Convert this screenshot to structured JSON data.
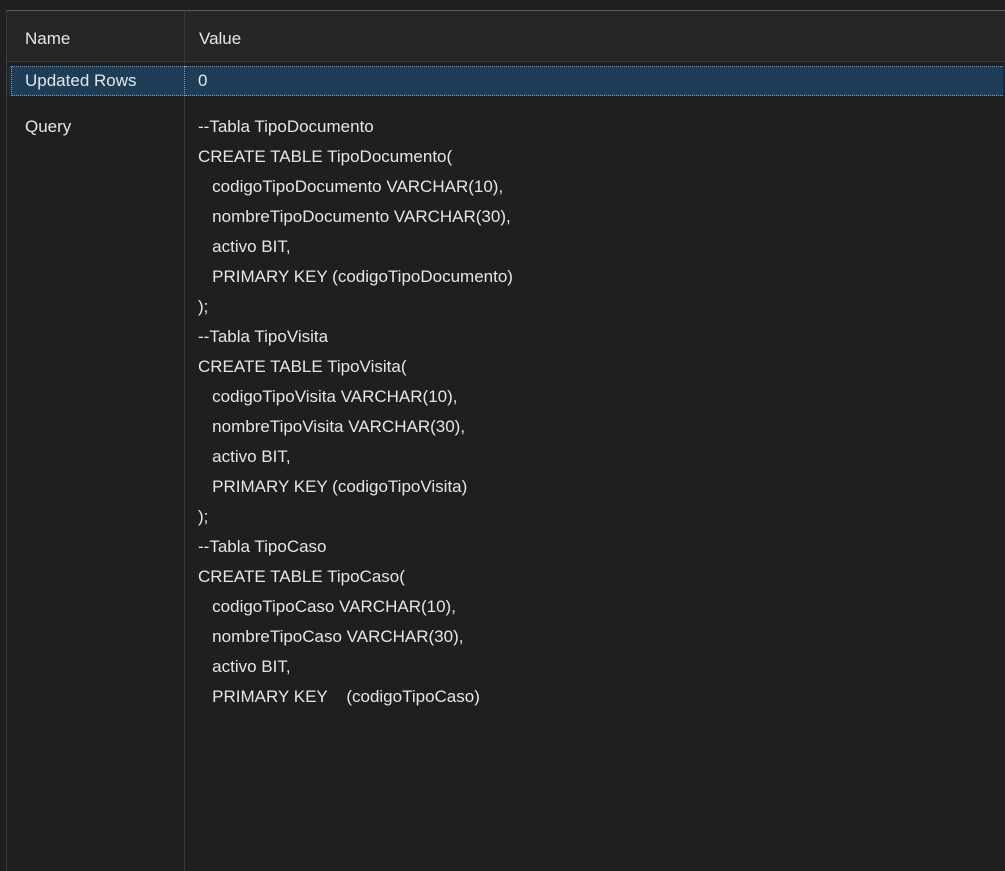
{
  "header": {
    "name": "Name",
    "value": "Value"
  },
  "rows": [
    {
      "name": "Updated Rows",
      "value": "0"
    }
  ],
  "query": {
    "name": "Query",
    "lines": [
      "--Tabla TipoDocumento",
      "CREATE TABLE TipoDocumento(",
      "   codigoTipoDocumento VARCHAR(10),",
      "   nombreTipoDocumento VARCHAR(30),",
      "   activo BIT,",
      "   PRIMARY KEY (codigoTipoDocumento)",
      ");",
      "--Tabla TipoVisita",
      "CREATE TABLE TipoVisita(",
      "   codigoTipoVisita VARCHAR(10),",
      "   nombreTipoVisita VARCHAR(30),",
      "   activo BIT,",
      "   PRIMARY KEY (codigoTipoVisita)",
      ");",
      "--Tabla TipoCaso",
      "CREATE TABLE TipoCaso(",
      "   codigoTipoCaso VARCHAR(10),",
      "   nombreTipoCaso VARCHAR(30),",
      "   activo BIT,",
      "   PRIMARY KEY    (codigoTipoCaso)"
    ]
  },
  "colors": {
    "background": "#1f1f1f",
    "selection": "#1f3d57",
    "text": "#e6e6e6"
  }
}
